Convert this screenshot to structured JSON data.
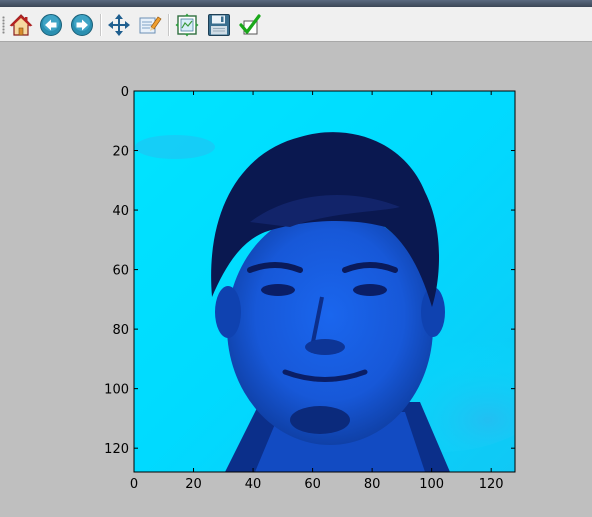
{
  "toolbar": {
    "items": [
      {
        "name": "home",
        "icon": "home-icon"
      },
      {
        "name": "back",
        "icon": "back-arrow-icon"
      },
      {
        "name": "forward",
        "icon": "forward-arrow-icon"
      },
      {
        "name": "pan",
        "icon": "pan-arrows-icon"
      },
      {
        "name": "zoom-to-rect",
        "icon": "zoom-rect-icon"
      },
      {
        "name": "configure-subplots",
        "icon": "subplots-icon"
      },
      {
        "name": "save",
        "icon": "save-disk-icon"
      },
      {
        "name": "edit-parameters",
        "icon": "checkmark-icon"
      }
    ]
  },
  "figure": {
    "image_description": "grayscale face photo rendered with a cyan-blue colormap",
    "colormap_colors": [
      "#00e5ff",
      "#0a1a5a"
    ]
  },
  "chart_data": {
    "type": "image",
    "xlim": [
      0,
      128
    ],
    "ylim": [
      128,
      0
    ],
    "xticks": [
      "0",
      "20",
      "40",
      "60",
      "80",
      "100",
      "120"
    ],
    "yticks": [
      "0",
      "20",
      "40",
      "60",
      "80",
      "100",
      "120"
    ],
    "xtick_values": [
      0,
      20,
      40,
      60,
      80,
      100,
      120
    ],
    "ytick_values": [
      0,
      20,
      40,
      60,
      80,
      100,
      120
    ],
    "title": "",
    "xlabel": "",
    "ylabel": "",
    "grid": false
  }
}
